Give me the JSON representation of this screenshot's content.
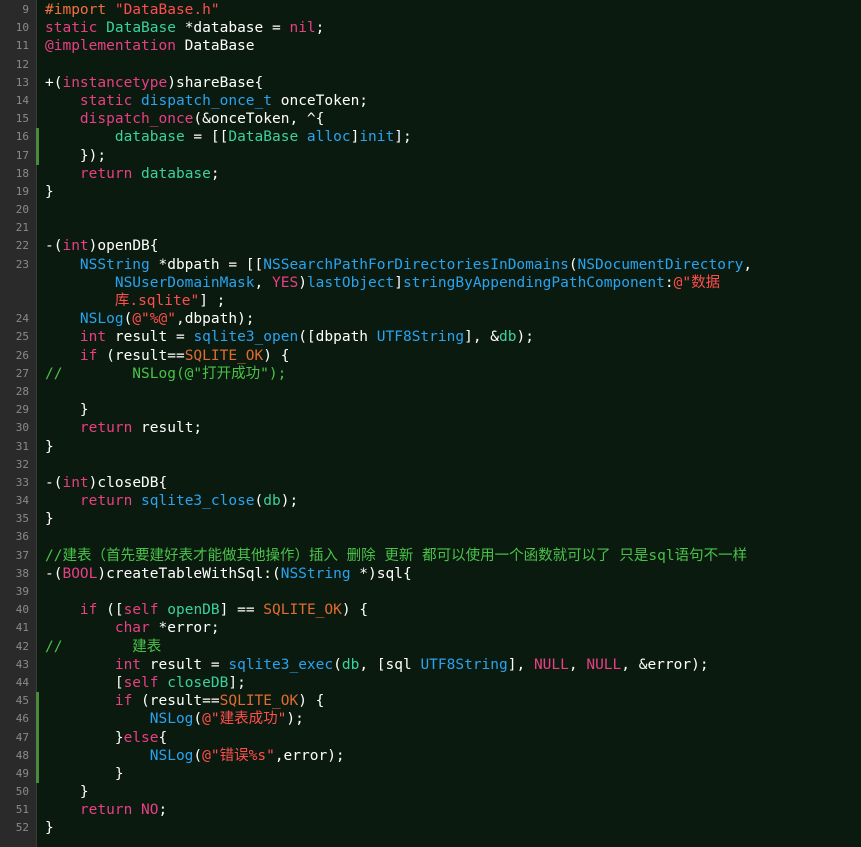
{
  "editor": {
    "colors": {
      "background": "#0b1a0e",
      "gutter": "#2a2a2a",
      "keyword": "#e93f86",
      "directive": "#f36f3f",
      "string": "#ff4e4e",
      "class": "#3bd1a0",
      "library": "#29a3f0",
      "comment": "#49c24a",
      "change_marker": "#4c8a3c"
    },
    "lines": [
      {
        "n": "9",
        "marked": false,
        "wrap": 1,
        "tokens": [
          [
            "dir",
            "#import"
          ],
          [
            "plain",
            " "
          ],
          [
            "str",
            "\"DataBase.h\""
          ]
        ]
      },
      {
        "n": "10",
        "marked": false,
        "wrap": 1,
        "tokens": [
          [
            "kw",
            "static"
          ],
          [
            "plain",
            " "
          ],
          [
            "cls",
            "DataBase"
          ],
          [
            "plain",
            " *database = "
          ],
          [
            "kw",
            "nil"
          ],
          [
            "plain",
            ";"
          ]
        ]
      },
      {
        "n": "11",
        "marked": false,
        "wrap": 1,
        "tokens": [
          [
            "kw",
            "@implementation"
          ],
          [
            "plain",
            " DataBase"
          ]
        ]
      },
      {
        "n": "12",
        "marked": false,
        "wrap": 1,
        "tokens": []
      },
      {
        "n": "13",
        "marked": false,
        "wrap": 1,
        "tokens": [
          [
            "plain",
            "+("
          ],
          [
            "kw",
            "instancetype"
          ],
          [
            "plain",
            ")shareBase{"
          ]
        ]
      },
      {
        "n": "14",
        "marked": false,
        "wrap": 1,
        "tokens": [
          [
            "plain",
            "    "
          ],
          [
            "kw",
            "static"
          ],
          [
            "plain",
            " "
          ],
          [
            "lib",
            "dispatch_once_t"
          ],
          [
            "plain",
            " onceToken;"
          ]
        ]
      },
      {
        "n": "15",
        "marked": false,
        "wrap": 1,
        "tokens": [
          [
            "plain",
            "    "
          ],
          [
            "kw",
            "dispatch_once"
          ],
          [
            "plain",
            "(&onceToken, ^{"
          ]
        ]
      },
      {
        "n": "16",
        "marked": true,
        "wrap": 1,
        "tokens": [
          [
            "plain",
            "        "
          ],
          [
            "cls",
            "database"
          ],
          [
            "plain",
            " = [["
          ],
          [
            "cls",
            "DataBase"
          ],
          [
            "plain",
            " "
          ],
          [
            "lib",
            "alloc"
          ],
          [
            "plain",
            "]"
          ],
          [
            "lib",
            "init"
          ],
          [
            "plain",
            "];"
          ]
        ]
      },
      {
        "n": "17",
        "marked": true,
        "wrap": 1,
        "tokens": [
          [
            "plain",
            "    });"
          ]
        ]
      },
      {
        "n": "18",
        "marked": false,
        "wrap": 1,
        "tokens": [
          [
            "plain",
            "    "
          ],
          [
            "kw",
            "return"
          ],
          [
            "plain",
            " "
          ],
          [
            "cls",
            "database"
          ],
          [
            "plain",
            ";"
          ]
        ]
      },
      {
        "n": "19",
        "marked": false,
        "wrap": 1,
        "tokens": [
          [
            "plain",
            "}"
          ]
        ]
      },
      {
        "n": "20",
        "marked": false,
        "wrap": 1,
        "tokens": []
      },
      {
        "n": "21",
        "marked": false,
        "wrap": 1,
        "tokens": []
      },
      {
        "n": "22",
        "marked": false,
        "wrap": 1,
        "tokens": [
          [
            "plain",
            "-("
          ],
          [
            "kw",
            "int"
          ],
          [
            "plain",
            ")openDB{"
          ]
        ]
      },
      {
        "n": "23",
        "marked": false,
        "wrap": 3,
        "tokens": [
          [
            "plain",
            "    "
          ],
          [
            "lib",
            "NSString"
          ],
          [
            "plain",
            " *dbpath = [["
          ],
          [
            "lib",
            "NSSearchPathForDirectoriesInDomains"
          ],
          [
            "plain",
            "("
          ],
          [
            "lib",
            "NSDocumentDirectory"
          ],
          [
            "plain",
            ",\n        "
          ],
          [
            "lib",
            "NSUserDomainMask"
          ],
          [
            "plain",
            ", "
          ],
          [
            "kw",
            "YES"
          ],
          [
            "plain",
            ")"
          ],
          [
            "lib",
            "lastObject"
          ],
          [
            "plain",
            "]"
          ],
          [
            "lib",
            "stringByAppendingPathComponent"
          ],
          [
            "plain",
            ":"
          ],
          [
            "str",
            "@\"数据\n        库.sqlite\""
          ],
          [
            "plain",
            "] ;"
          ]
        ]
      },
      {
        "n": "24",
        "marked": false,
        "wrap": 1,
        "tokens": [
          [
            "plain",
            "    "
          ],
          [
            "lib",
            "NSLog"
          ],
          [
            "plain",
            "("
          ],
          [
            "str",
            "@\"%@\""
          ],
          [
            "plain",
            ",dbpath);"
          ]
        ]
      },
      {
        "n": "25",
        "marked": false,
        "wrap": 1,
        "tokens": [
          [
            "plain",
            "    "
          ],
          [
            "kw",
            "int"
          ],
          [
            "plain",
            " result = "
          ],
          [
            "lib",
            "sqlite3_open"
          ],
          [
            "plain",
            "([dbpath "
          ],
          [
            "lib",
            "UTF8String"
          ],
          [
            "plain",
            "], &"
          ],
          [
            "cls",
            "db"
          ],
          [
            "plain",
            ");"
          ]
        ]
      },
      {
        "n": "26",
        "marked": false,
        "wrap": 1,
        "tokens": [
          [
            "plain",
            "    "
          ],
          [
            "kw",
            "if"
          ],
          [
            "plain",
            " (result=="
          ],
          [
            "mac",
            "SQLITE_OK"
          ],
          [
            "plain",
            ") {"
          ]
        ]
      },
      {
        "n": "27",
        "marked": false,
        "wrap": 1,
        "tokens": [
          [
            "cm",
            "//        NSLog(@\"打开成功\");"
          ]
        ]
      },
      {
        "n": "28",
        "marked": false,
        "wrap": 1,
        "tokens": []
      },
      {
        "n": "29",
        "marked": false,
        "wrap": 1,
        "tokens": [
          [
            "plain",
            "    }"
          ]
        ]
      },
      {
        "n": "30",
        "marked": false,
        "wrap": 1,
        "tokens": [
          [
            "plain",
            "    "
          ],
          [
            "kw",
            "return"
          ],
          [
            "plain",
            " result;"
          ]
        ]
      },
      {
        "n": "31",
        "marked": false,
        "wrap": 1,
        "tokens": [
          [
            "plain",
            "}"
          ]
        ]
      },
      {
        "n": "32",
        "marked": false,
        "wrap": 1,
        "tokens": []
      },
      {
        "n": "33",
        "marked": false,
        "wrap": 1,
        "tokens": [
          [
            "plain",
            "-("
          ],
          [
            "kw",
            "int"
          ],
          [
            "plain",
            ")closeDB{"
          ]
        ]
      },
      {
        "n": "34",
        "marked": false,
        "wrap": 1,
        "tokens": [
          [
            "plain",
            "    "
          ],
          [
            "kw",
            "return"
          ],
          [
            "plain",
            " "
          ],
          [
            "lib",
            "sqlite3_close"
          ],
          [
            "plain",
            "("
          ],
          [
            "cls",
            "db"
          ],
          [
            "plain",
            ");"
          ]
        ]
      },
      {
        "n": "35",
        "marked": false,
        "wrap": 1,
        "tokens": [
          [
            "plain",
            "}"
          ]
        ]
      },
      {
        "n": "36",
        "marked": false,
        "wrap": 1,
        "tokens": []
      },
      {
        "n": "37",
        "marked": false,
        "wrap": 1,
        "tokens": [
          [
            "cm",
            "//建表（首先要建好表才能做其他操作）插入 删除 更新 都可以使用一个函数就可以了 只是sql语句不一样"
          ]
        ]
      },
      {
        "n": "38",
        "marked": false,
        "wrap": 1,
        "tokens": [
          [
            "plain",
            "-("
          ],
          [
            "kw",
            "BOOL"
          ],
          [
            "plain",
            ")createTableWithSql:("
          ],
          [
            "lib",
            "NSString"
          ],
          [
            "plain",
            " *)sql{"
          ]
        ]
      },
      {
        "n": "39",
        "marked": false,
        "wrap": 1,
        "tokens": []
      },
      {
        "n": "40",
        "marked": false,
        "wrap": 1,
        "tokens": [
          [
            "plain",
            "    "
          ],
          [
            "kw",
            "if"
          ],
          [
            "plain",
            " (["
          ],
          [
            "kw",
            "self"
          ],
          [
            "plain",
            " "
          ],
          [
            "cls",
            "openDB"
          ],
          [
            "plain",
            "] == "
          ],
          [
            "mac",
            "SQLITE_OK"
          ],
          [
            "plain",
            ") {"
          ]
        ]
      },
      {
        "n": "41",
        "marked": false,
        "wrap": 1,
        "tokens": [
          [
            "plain",
            "        "
          ],
          [
            "kw",
            "char"
          ],
          [
            "plain",
            " *error;"
          ]
        ]
      },
      {
        "n": "42",
        "marked": false,
        "wrap": 1,
        "tokens": [
          [
            "cm",
            "//        建表"
          ]
        ]
      },
      {
        "n": "43",
        "marked": false,
        "wrap": 1,
        "tokens": [
          [
            "plain",
            "        "
          ],
          [
            "kw",
            "int"
          ],
          [
            "plain",
            " result = "
          ],
          [
            "lib",
            "sqlite3_exec"
          ],
          [
            "plain",
            "("
          ],
          [
            "cls",
            "db"
          ],
          [
            "plain",
            ", [sql "
          ],
          [
            "lib",
            "UTF8String"
          ],
          [
            "plain",
            "], "
          ],
          [
            "kw",
            "NULL"
          ],
          [
            "plain",
            ", "
          ],
          [
            "kw",
            "NULL"
          ],
          [
            "plain",
            ", &error);"
          ]
        ]
      },
      {
        "n": "44",
        "marked": false,
        "wrap": 1,
        "tokens": [
          [
            "plain",
            "        ["
          ],
          [
            "kw",
            "self"
          ],
          [
            "plain",
            " "
          ],
          [
            "cls",
            "closeDB"
          ],
          [
            "plain",
            "];"
          ]
        ]
      },
      {
        "n": "45",
        "marked": true,
        "wrap": 1,
        "tokens": [
          [
            "plain",
            "        "
          ],
          [
            "kw",
            "if"
          ],
          [
            "plain",
            " (result=="
          ],
          [
            "mac",
            "SQLITE_OK"
          ],
          [
            "plain",
            ") {"
          ]
        ]
      },
      {
        "n": "46",
        "marked": true,
        "wrap": 1,
        "tokens": [
          [
            "plain",
            "            "
          ],
          [
            "lib",
            "NSLog"
          ],
          [
            "plain",
            "("
          ],
          [
            "str",
            "@\"建表成功\""
          ],
          [
            "plain",
            ");"
          ]
        ]
      },
      {
        "n": "47",
        "marked": true,
        "wrap": 1,
        "tokens": [
          [
            "plain",
            "        }"
          ],
          [
            "kw",
            "else"
          ],
          [
            "plain",
            "{"
          ]
        ]
      },
      {
        "n": "48",
        "marked": true,
        "wrap": 1,
        "tokens": [
          [
            "plain",
            "            "
          ],
          [
            "lib",
            "NSLog"
          ],
          [
            "plain",
            "("
          ],
          [
            "str",
            "@\"错误%s\""
          ],
          [
            "plain",
            ",error);"
          ]
        ]
      },
      {
        "n": "49",
        "marked": true,
        "wrap": 1,
        "tokens": [
          [
            "plain",
            "        }"
          ]
        ]
      },
      {
        "n": "50",
        "marked": false,
        "wrap": 1,
        "tokens": [
          [
            "plain",
            "    }"
          ]
        ]
      },
      {
        "n": "51",
        "marked": false,
        "wrap": 1,
        "tokens": [
          [
            "plain",
            "    "
          ],
          [
            "kw",
            "return"
          ],
          [
            "plain",
            " "
          ],
          [
            "kw",
            "NO"
          ],
          [
            "plain",
            ";"
          ]
        ]
      },
      {
        "n": "52",
        "marked": false,
        "wrap": 1,
        "tokens": [
          [
            "plain",
            "}"
          ]
        ]
      }
    ]
  }
}
